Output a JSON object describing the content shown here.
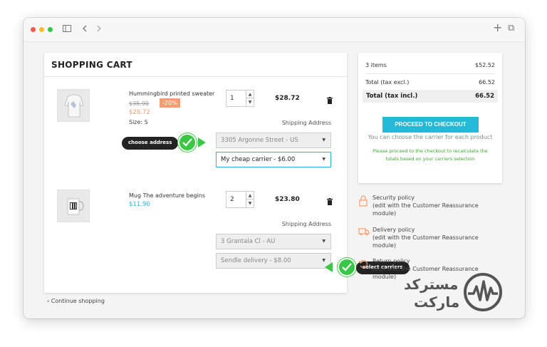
{
  "browser": {
    "plus_icon": "+",
    "tabs_icon": "⧉"
  },
  "cart": {
    "title": "SHOPPING CART",
    "items": [
      {
        "name": "Hummingbird printed sweater",
        "old_price": "$35.90",
        "discount": "-20%",
        "price": "$28.72",
        "size": "Size: S",
        "quantity": "1",
        "total": "$28.72",
        "shipping_label": "Shipping Address",
        "address": "3305 Argonne Street - US",
        "carrier": "My cheap carrier - $6.00"
      },
      {
        "name": "Mug The adventure begins",
        "price": "$11.90",
        "quantity": "2",
        "total": "$23.80",
        "shipping_label": "Shipping Address",
        "address": "3 Grantala Cl - AU",
        "carrier": "Sendle delivery - $8.00"
      }
    ],
    "continue_label": "Continue shopping"
  },
  "callouts": {
    "choose_address": "choose address",
    "select_carriers": "select carriers"
  },
  "summary": {
    "items_label": "3 items",
    "items_value": "$52.52",
    "tax_excl_label": "Total (tax excl.)",
    "tax_excl_value": "66.52",
    "tax_incl_label": "Total (tax incl.)",
    "tax_incl_value": "66.52",
    "checkout_label": "PROCEED TO CHECKOUT",
    "carrier_note": "You can choose the carrier for each product",
    "green_note": "Please proceed to the checkout to recalculate the totals based on your carriers selection"
  },
  "reassurance": [
    {
      "title": "Security policy",
      "sub": "(edit with the Customer Reassurance module)",
      "icon": "lock-icon"
    },
    {
      "title": "Delivery policy",
      "sub": "(edit with the Customer Reassurance module)",
      "icon": "truck-icon"
    },
    {
      "title": "Return policy",
      "sub": "(edit with the Customer Reassurance module)",
      "icon": "return-icon"
    }
  ],
  "watermark": {
    "line1": "مسترکد",
    "line2": "مارکت"
  },
  "colors": {
    "accent": "#24b9d7",
    "discount": "#f39d72",
    "callout_green": "#38c845",
    "note_green": "#3aa72e"
  }
}
